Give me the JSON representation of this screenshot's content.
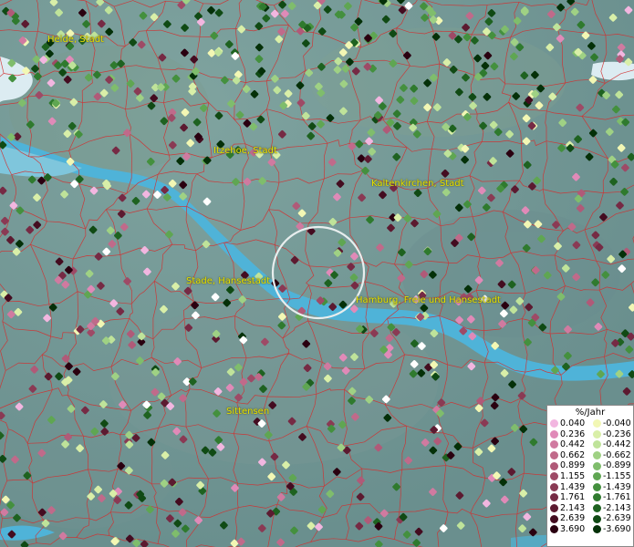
{
  "cities": [
    {
      "name": "Heide, Stadt",
      "id": "heide"
    },
    {
      "name": "Itzehoe, Stadt",
      "id": "itzehoe"
    },
    {
      "name": "Kaltenkirchen, Stadt",
      "id": "kaltenkirchen"
    },
    {
      "name": "Stade, Hansestadt",
      "id": "stade"
    },
    {
      "name": "Hamburg, Freie und Hansestadt",
      "id": "hamburg"
    },
    {
      "name": "Sittensen",
      "id": "sittensen"
    }
  ],
  "legend": {
    "title": "%/Jahr",
    "positive": [
      {
        "label": "0.040",
        "color": "#f2b6e0"
      },
      {
        "label": "0.236",
        "color": "#e08ab8"
      },
      {
        "label": "0.442",
        "color": "#d07aa0"
      },
      {
        "label": "0.662",
        "color": "#c06a8a"
      },
      {
        "label": "0.899",
        "color": "#b05a78"
      },
      {
        "label": "1.155",
        "color": "#9e4a66"
      },
      {
        "label": "1.439",
        "color": "#8a3a54"
      },
      {
        "label": "1.761",
        "color": "#762a44"
      },
      {
        "label": "2.143",
        "color": "#5c1a30"
      },
      {
        "label": "2.639",
        "color": "#440c20"
      },
      {
        "label": "3.690",
        "color": "#2a0010"
      }
    ],
    "negative": [
      {
        "label": "-0.040",
        "color": "#f2f7b4"
      },
      {
        "label": "-0.236",
        "color": "#d9efa8"
      },
      {
        "label": "-0.442",
        "color": "#bfe39a"
      },
      {
        "label": "-0.662",
        "color": "#9fd184"
      },
      {
        "label": "-0.899",
        "color": "#7fbd6c"
      },
      {
        "label": "-1.155",
        "color": "#5fa652"
      },
      {
        "label": "-1.439",
        "color": "#44903e"
      },
      {
        "label": "-1.761",
        "color": "#2f7a2e"
      },
      {
        "label": "-2.143",
        "color": "#1e6220"
      },
      {
        "label": "-2.639",
        "color": "#104a14"
      },
      {
        "label": "-3.690",
        "color": "#043008"
      }
    ]
  },
  "colors": {
    "water": "#3aa0c8",
    "land": "#6f9393",
    "boundaries": "#d02828",
    "label": "#e8e000"
  }
}
